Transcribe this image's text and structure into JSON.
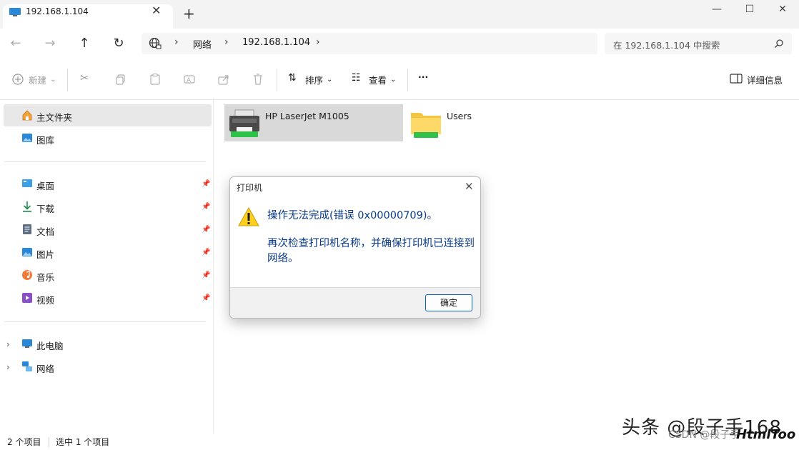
{
  "window": {
    "tab_title": "192.168.1.104",
    "new_tab": "+",
    "controls": {
      "minimize": "—",
      "maximize": "☐",
      "close": "✕"
    }
  },
  "nav": {
    "breadcrumbs": [
      "网络",
      "192.168.1.104"
    ],
    "search_placeholder": "在 192.168.1.104 中搜索"
  },
  "toolbar": {
    "new_label": "新建",
    "sort_label": "排序",
    "view_label": "查看",
    "more": "···",
    "details_label": "详细信息"
  },
  "sidebar": {
    "home": "主文件夹",
    "gallery": "图库",
    "pinned": [
      "桌面",
      "下载",
      "文档",
      "图片",
      "音乐",
      "视频"
    ],
    "this_pc": "此电脑",
    "network": "网络"
  },
  "content": {
    "items": [
      "HP LaserJet M1005",
      "Users"
    ]
  },
  "status": {
    "count": "2 个项目",
    "selected": "选中 1 个项目"
  },
  "dialog": {
    "title": "打印机",
    "message_line1": "操作无法完成(错误 0x00000709)。",
    "message_line2": "再次检查打印机名称，并确保打印机已连接到网络。",
    "ok_label": "确定"
  },
  "watermark": {
    "text": "头条 @段子手168",
    "small": "CSDN @段子手",
    "brand": "HtmlToo"
  },
  "colors": {
    "accent": "#0a63c9",
    "dialog_text": "#0a3a8a",
    "selected_bg": "#d9d9d9"
  }
}
